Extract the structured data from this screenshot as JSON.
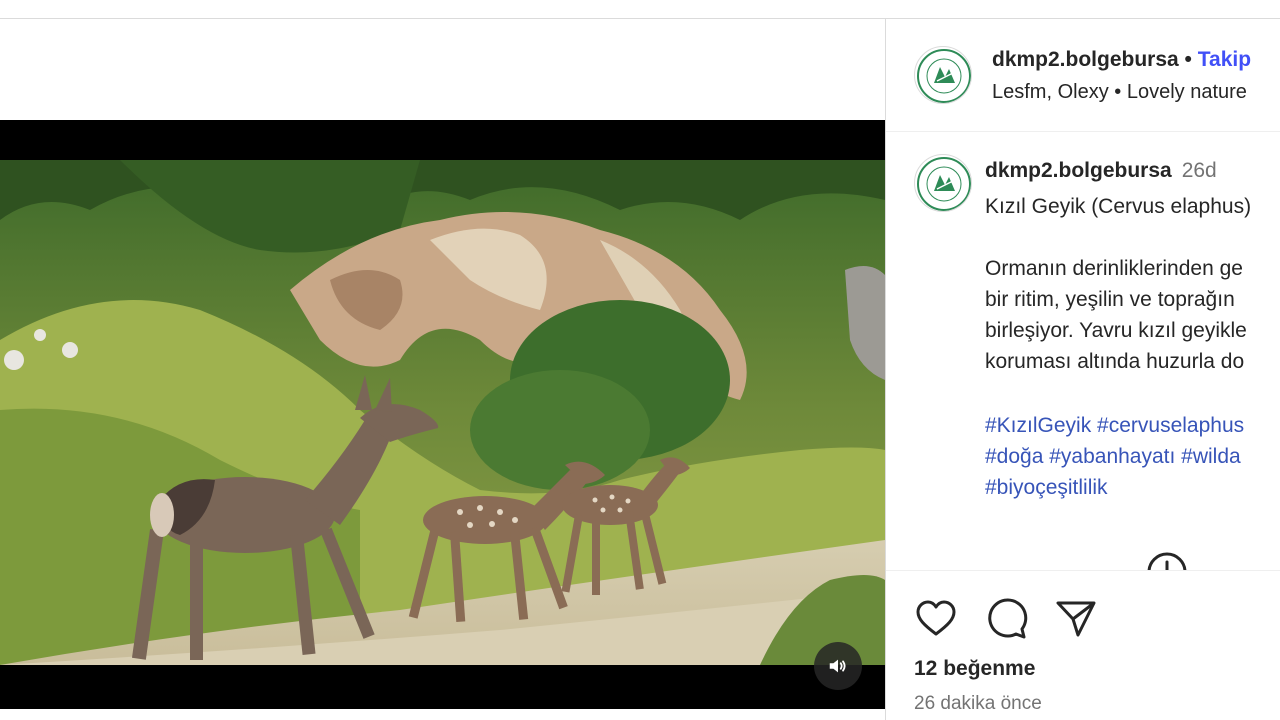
{
  "post": {
    "username": "dkmp2.bolgebursa",
    "follow_label": "Takip",
    "separator": "•",
    "audio": {
      "artists": "Lesfm, Olexy",
      "track": "Lovely nature"
    }
  },
  "caption": {
    "username": "dkmp2.bolgebursa",
    "age": "26d",
    "title": "Kızıl Geyik (Cervus elaphus)",
    "body_lines": [
      "Ormanın derinliklerinden ge",
      "bir ritim, yeşilin ve toprağın",
      "birleşiyor. Yavru kızıl geyikle",
      "koruması altında huzurla do"
    ],
    "hashtag_lines": [
      "#KızılGeyik #cervuselaphus",
      "#doğa #yabanhayatı #wilda",
      "#biyoçeşitlilik"
    ]
  },
  "stats": {
    "likes": "12 beğenme",
    "time_ago": "26 dakika önce"
  },
  "icons": {
    "like": "heart-icon",
    "comment": "comment-icon",
    "share": "share-icon",
    "mute": "speaker-icon",
    "more": "more-options-icon"
  },
  "colors": {
    "follow": "#4150f7",
    "hashtag": "#3754b8",
    "muted_text": "#737373",
    "divider": "#dbdbdb"
  }
}
